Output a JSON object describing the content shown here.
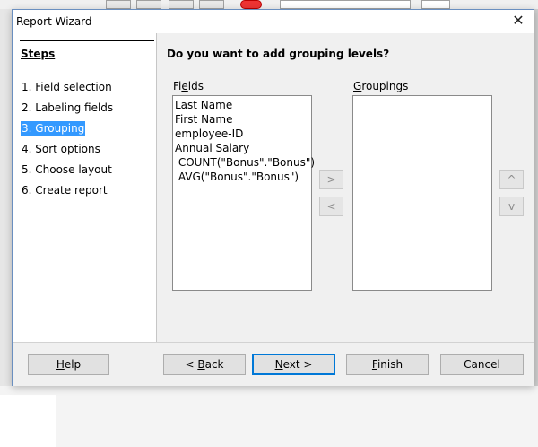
{
  "dialog": {
    "title": "Report Wizard",
    "close_icon": "close-icon"
  },
  "steps": {
    "heading": "Steps",
    "items": [
      {
        "label": "1. Field selection",
        "active": false
      },
      {
        "label": "2. Labeling fields",
        "active": false
      },
      {
        "label": "3. Grouping",
        "active": true
      },
      {
        "label": "4. Sort options",
        "active": false
      },
      {
        "label": "5. Choose layout",
        "active": false
      },
      {
        "label": "6. Create report",
        "active": false
      }
    ]
  },
  "main": {
    "question": "Do you want to add grouping levels?",
    "fields_label_pre": "Fi",
    "fields_label_mn": "e",
    "fields_label_post": "lds",
    "groupings_label_mn": "G",
    "groupings_label_post": "roupings",
    "fields": [
      "Last Name",
      "First Name",
      "employee-ID",
      "Annual Salary",
      " COUNT(\"Bonus\".\"Bonus\")",
      " AVG(\"Bonus\".\"Bonus\")"
    ],
    "groupings": [],
    "add_label": ">",
    "remove_label": "<",
    "up_label": "^",
    "down_label": "v"
  },
  "footer": {
    "help_mn": "H",
    "help_post": "elp",
    "back_pre": "< ",
    "back_mn": "B",
    "back_post": "ack",
    "next_mn": "N",
    "next_post": "ext >",
    "finish_mn": "F",
    "finish_post": "inish",
    "cancel_label": "Cancel"
  },
  "colors": {
    "selection": "#3399ff",
    "default_button_border": "#0078d7"
  }
}
